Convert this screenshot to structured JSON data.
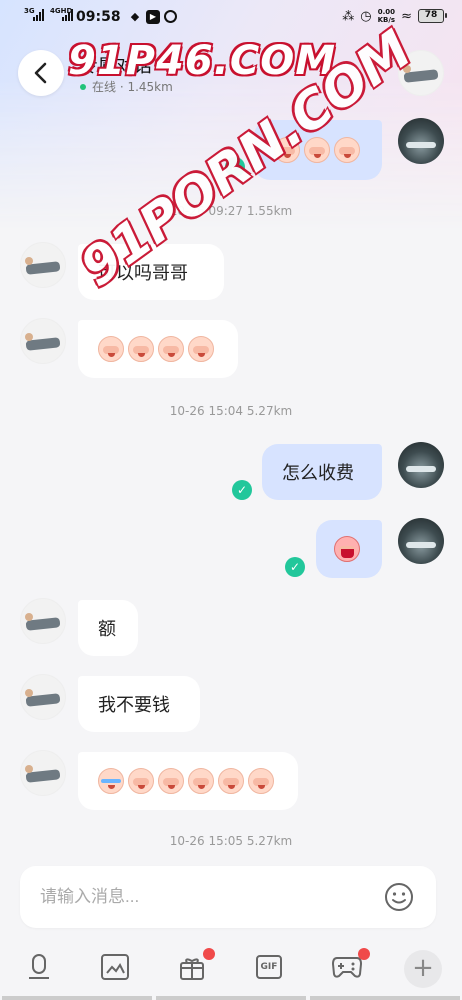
{
  "status_bar": {
    "net1": "3G",
    "net2": "4GHD",
    "time": "09:58",
    "speed_value": "0.00",
    "speed_unit": "KB/s",
    "battery": "78"
  },
  "header": {
    "contact_name": "专属对话",
    "online_status": "在线 · 1.45km",
    "watermark_top": "91P46.COM",
    "watermark_diag": "91PORN.COM"
  },
  "messages": {
    "m1_emojis": [
      "covered",
      "covered",
      "covered"
    ],
    "ts1": "10-26 09:27  1.55km",
    "m2_text": "可以吗哥哥",
    "m3_emojis": [
      "covered",
      "covered",
      "covered",
      "covered"
    ],
    "ts2": "10-26 15:04  5.27km",
    "m4_text": "怎么收费",
    "m5_emojis": [
      "laugh"
    ],
    "m6_text": "额",
    "m7_text": "我不要钱",
    "m8_emojis": [
      "cry",
      "covered",
      "covered",
      "covered",
      "covered",
      "covered"
    ],
    "ts3": "10-26 15:05  5.27km"
  },
  "input": {
    "placeholder": "请输入消息..."
  },
  "toolbar": {
    "items": [
      "microphone-icon",
      "image-icon",
      "gift-icon",
      "gif-icon",
      "game-icon"
    ],
    "gif_label": "GIF",
    "plus_label": "+"
  },
  "colors": {
    "accent_check": "#22c79b",
    "self_bubble": "#d7e3ff",
    "badge_red": "#f04a4a"
  }
}
